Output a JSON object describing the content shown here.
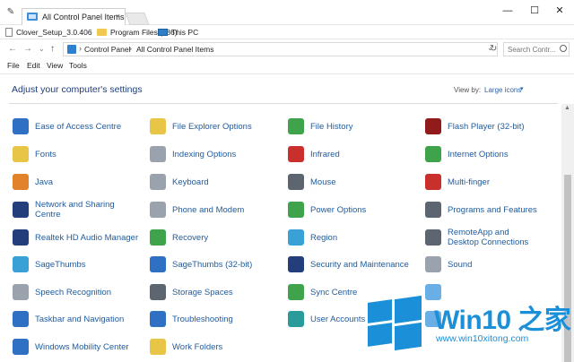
{
  "window": {
    "tab_title": "All Control Panel Items",
    "tab_close": "×",
    "minimize": "—",
    "maximize": "☐",
    "close": "✕"
  },
  "bookmarks": [
    {
      "label": "Clover_Setup_3.0.406",
      "icon": "document-icon"
    },
    {
      "label": "Program Files (x86)",
      "icon": "folder-icon"
    },
    {
      "label": "This PC",
      "icon": "computer-icon"
    }
  ],
  "address": {
    "back": "←",
    "forward": "→",
    "dropdown": "⌄",
    "up": "↑",
    "crumbs": [
      "Control Panel",
      "All Control Panel Items"
    ],
    "separator": "›",
    "refresh": "↻",
    "search_placeholder": "Search Contr..."
  },
  "menu": [
    "File",
    "Edit",
    "View",
    "Tools"
  ],
  "content": {
    "heading": "Adjust your computer's settings",
    "view_by_label": "View by:",
    "view_by_value": "Large icons",
    "view_by_caret": "▾"
  },
  "items": [
    {
      "label": "Ease of Access Centre",
      "icon": "ease-of-access-icon",
      "color": "#2f6fc4"
    },
    {
      "label": "File Explorer Options",
      "icon": "folder-options-icon",
      "color": "#e8c447"
    },
    {
      "label": "File History",
      "icon": "file-history-icon",
      "color": "#3ea34b"
    },
    {
      "label": "Flash Player (32-bit)",
      "icon": "flash-player-icon",
      "color": "#8f1b1b"
    },
    {
      "label": "Fonts",
      "icon": "fonts-icon",
      "color": "#e8c447"
    },
    {
      "label": "Indexing Options",
      "icon": "indexing-icon",
      "color": "#9aa3ad"
    },
    {
      "label": "Infrared",
      "icon": "infrared-icon",
      "color": "#c9302c"
    },
    {
      "label": "Internet Options",
      "icon": "internet-options-icon",
      "color": "#3ea34b"
    },
    {
      "label": "Java",
      "icon": "java-icon",
      "color": "#e2822b"
    },
    {
      "label": "Keyboard",
      "icon": "keyboard-icon",
      "color": "#9aa3ad"
    },
    {
      "label": "Mouse",
      "icon": "mouse-icon",
      "color": "#5c6570"
    },
    {
      "label": "Multi-finger",
      "icon": "multi-finger-icon",
      "color": "#c9302c"
    },
    {
      "label": "Network and Sharing Centre",
      "icon": "network-icon",
      "color": "#233e7a"
    },
    {
      "label": "Phone and Modem",
      "icon": "phone-modem-icon",
      "color": "#9aa3ad"
    },
    {
      "label": "Power Options",
      "icon": "power-options-icon",
      "color": "#3ea34b"
    },
    {
      "label": "Programs and Features",
      "icon": "programs-icon",
      "color": "#5c6570"
    },
    {
      "label": "Realtek HD Audio Manager",
      "icon": "realtek-audio-icon",
      "color": "#233e7a"
    },
    {
      "label": "Recovery",
      "icon": "recovery-icon",
      "color": "#3ea34b"
    },
    {
      "label": "Region",
      "icon": "region-icon",
      "color": "#39a1d6"
    },
    {
      "label": "RemoteApp and Desktop Connections",
      "icon": "remoteapp-icon",
      "color": "#5c6570"
    },
    {
      "label": "SageThumbs",
      "icon": "sagethumbs-icon",
      "color": "#39a1d6"
    },
    {
      "label": "SageThumbs (32-bit)",
      "icon": "sagethumbs-32-icon",
      "color": "#2f6fc4"
    },
    {
      "label": "Security and Maintenance",
      "icon": "security-flag-icon",
      "color": "#233e7a"
    },
    {
      "label": "Sound",
      "icon": "sound-icon",
      "color": "#9aa3ad"
    },
    {
      "label": "Speech Recognition",
      "icon": "microphone-icon",
      "color": "#9aa3ad"
    },
    {
      "label": "Storage Spaces",
      "icon": "storage-spaces-icon",
      "color": "#5c6570"
    },
    {
      "label": "Sync Centre",
      "icon": "sync-icon",
      "color": "#3ea34b"
    },
    {
      "label": "",
      "icon": "partially-hidden-icon",
      "color": "#6aaee6"
    },
    {
      "label": "Taskbar and Navigation",
      "icon": "taskbar-icon",
      "color": "#2f6fc4"
    },
    {
      "label": "Troubleshooting",
      "icon": "troubleshooting-icon",
      "color": "#2f6fc4"
    },
    {
      "label": "User Accounts",
      "icon": "user-accounts-icon",
      "color": "#2a9b9b"
    },
    {
      "label": "",
      "icon": "partially-hidden-icon",
      "color": "#6aaee6"
    },
    {
      "label": "Windows Mobility Center",
      "icon": "mobility-center-icon",
      "color": "#2f6fc4"
    },
    {
      "label": "Work Folders",
      "icon": "work-folders-icon",
      "color": "#e8c447"
    }
  ],
  "watermark": {
    "brand": "Win10 之家",
    "url": "www.win10xitong.com",
    "color": "#1b90d9"
  }
}
